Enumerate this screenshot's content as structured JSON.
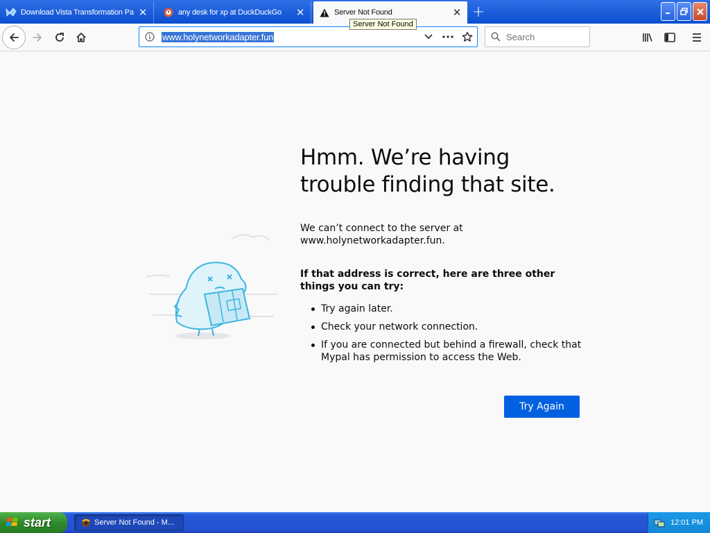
{
  "tabs": [
    {
      "label": "Download Vista Transformation Pa",
      "icon": "vista-icon",
      "active": false
    },
    {
      "label": "any desk for xp at DuckDuckGo",
      "icon": "duckduckgo-icon",
      "active": false
    },
    {
      "label": "Server Not Found",
      "icon": "warning-icon",
      "active": true
    }
  ],
  "tooltip": "Server Not Found",
  "navbar": {
    "url": "www.holynetworkadapter.fun",
    "search_placeholder": "Search"
  },
  "error": {
    "title": "Hmm. We’re having trouble finding that site.",
    "description": "We can’t connect to the server at www.holynetworkadapter.fun.",
    "subheading": "If that address is correct, here are three other things you can try:",
    "suggestions": [
      "Try again later.",
      "Check your network connection.",
      "If you are connected but behind a firewall, check that Mypal has permission to access the Web."
    ],
    "button_label": "Try Again"
  },
  "taskbar": {
    "start_label": "start",
    "task_label": "Server Not Found - M...",
    "clock": "12:01 PM"
  },
  "colors": {
    "accent": "#0060df",
    "taskbar": "#2353d3",
    "start": "#2f8a2b"
  }
}
